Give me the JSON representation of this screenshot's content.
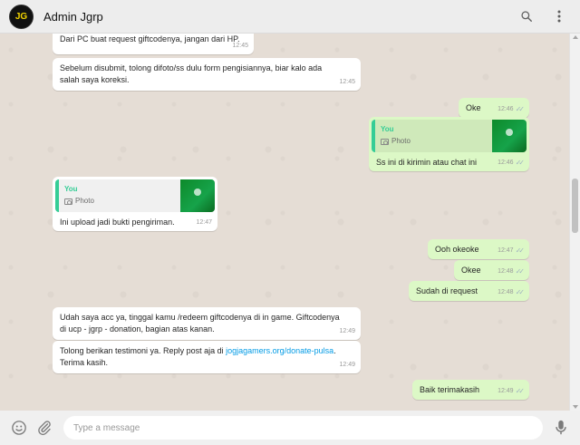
{
  "header": {
    "title": "Admin Jgrp",
    "avatar_text": "JG"
  },
  "messages": [
    {
      "text": "Dari PC buat request giftcodenya, jangan dari HP.",
      "time": "12:45"
    },
    {
      "text": "Sebelum disubmit, tolong difoto/ss dulu form pengisiannya, biar kalo ada salah saya koreksi.",
      "time": "12:45"
    },
    {
      "text": "Oke",
      "time": "12:46"
    },
    {
      "quote_name": "You",
      "quote_label": "Photo",
      "text": "Ss ini di kirimin atau chat ini",
      "time": "12:46"
    },
    {
      "quote_name": "You",
      "quote_label": "Photo",
      "text": "Ini upload jadi bukti pengiriman.",
      "time": "12:47"
    },
    {
      "text": "Ooh okeoke",
      "time": "12:47"
    },
    {
      "text": "Okee",
      "time": "12:48"
    },
    {
      "text": "Sudah di request",
      "time": "12:48"
    },
    {
      "text": "Udah saya acc ya, tinggal kamu /redeem giftcodenya di in game. Giftcodenya di ucp - jgrp - donation, bagian atas kanan.",
      "time": "12:49"
    },
    {
      "text_before": "Tolong berikan testimoni ya. Reply post aja di ",
      "link": "jogjagamers.org/donate-pulsa",
      "text_after": ". Terima kasih.",
      "time": "12:49"
    },
    {
      "text": "Baik terimakasih",
      "time": "12:49"
    }
  ],
  "composer": {
    "placeholder": "Type a message"
  },
  "icons": {
    "search": "search-icon",
    "menu": "menu-dots-icon",
    "emoji": "emoji-icon",
    "attach": "paperclip-icon",
    "mic": "microphone-icon",
    "read": "double-check-icon",
    "camera": "camera-icon"
  },
  "colors": {
    "incoming_bubble": "#ffffff",
    "outgoing_bubble": "#dcf8c6",
    "quote_accent": "#35cd96",
    "link": "#039be5",
    "chat_background": "#e5ddd5"
  }
}
